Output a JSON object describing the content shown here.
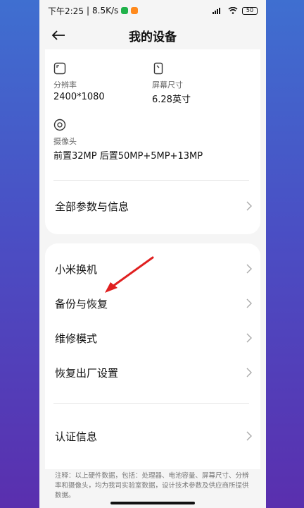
{
  "statusbar": {
    "time": "下午2:25",
    "separator": "|",
    "speed": "8.5K/s",
    "battery": "50"
  },
  "header": {
    "title": "我的设备"
  },
  "specs": {
    "resolution": {
      "label": "分辨率",
      "value": "2400*1080",
      "icon": "screen-icon"
    },
    "screen_size": {
      "label": "屏幕尺寸",
      "value": "6.28英寸",
      "icon": "phone-icon"
    },
    "camera": {
      "label": "摄像头",
      "value": "前置32MP 后置50MP+5MP+13MP",
      "icon": "camera-icon"
    }
  },
  "rows": {
    "all_params": "全部参数与信息",
    "mi_mover": "小米换机",
    "backup": "备份与恢复",
    "repair": "维修模式",
    "factory_reset": "恢复出厂设置",
    "certification": "认证信息"
  },
  "footnote": "注释：以上硬件数据，包括：处理器、电池容量、屏幕尺寸、分辨率和摄像头，均为我司实验室数据，设计技术参数及供应商所提供数据。",
  "colors": {
    "accent_arrow": "#e02020",
    "background_top": "#3f6fd0",
    "background_bottom": "#5a2fae"
  }
}
